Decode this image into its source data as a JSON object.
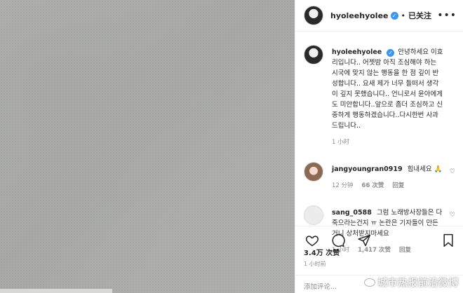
{
  "header": {
    "username": "hyoleehyolee",
    "follow_label": "已关注"
  },
  "caption": {
    "username": "hyoleehyolee",
    "text": "안녕하세요 이효리입니다.. 어젯밤 아직 조심해야 하는 시국에 맞지 않는 행동을 한 점 깊이 반성합니다.. 요새 제가 너무 들떠서 생각이 깊지 못했습니다.. 언니로서 윤아에게도 미안합니다..앞으로 좀더 조심하고 신중하게 행동하겠습니다..다시한번 사과드립니다..",
    "time": "1 小时"
  },
  "comments": [
    {
      "username": "jangyoungran0919",
      "text": "힘내세요 🙏",
      "time": "12 分钟",
      "likes": "66 次赞",
      "reply": "回复"
    },
    {
      "username": "sang_0588",
      "text": "그럼 노래방사장들은 다 죽으라는건지 ㅠ 논란은 기자들이 만든거니 상처받지마세요",
      "time": "1 小时",
      "likes": "1,417 次赞",
      "reply": "回复"
    }
  ],
  "likes": "3.4万 次赞",
  "post_time": "1 小时前",
  "add_comment_placeholder": "添加评论...",
  "watermark": "城市热报前沿微博",
  "icons": {
    "verified": "verified-badge-icon",
    "more": "more-options-icon",
    "heart": "heart-icon",
    "comment": "comment-icon",
    "share": "share-icon",
    "bookmark": "bookmark-icon"
  },
  "colors": {
    "verified": "#3897f0",
    "muted": "#8e8e8e",
    "text": "#262626"
  }
}
